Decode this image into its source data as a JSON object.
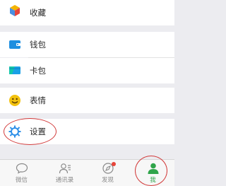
{
  "menu": {
    "favorites": "收藏",
    "wallet": "钱包",
    "cards": "卡包",
    "stickers": "表情",
    "settings": "设置"
  },
  "tabbar": {
    "chats": "微信",
    "contacts": "通讯录",
    "discover": "发现",
    "me": "我"
  },
  "colors": {
    "accent_green": "#2fa44a",
    "wallet_blue": "#1e8fe0",
    "cards_blue": "#1aa0e6",
    "settings_blue": "#2d8fe8",
    "stickers_yellow": "#f3c20f",
    "badge_red": "#e6453a",
    "annotation_red": "#d23a3a"
  },
  "icons": {
    "favorites": "cube-icon",
    "wallet": "wallet-icon",
    "cards": "card-icon",
    "stickers": "smiley-icon",
    "settings": "gear-icon",
    "chats": "chat-bubble-icon",
    "contacts": "contacts-icon",
    "discover": "compass-icon",
    "me": "person-icon"
  }
}
